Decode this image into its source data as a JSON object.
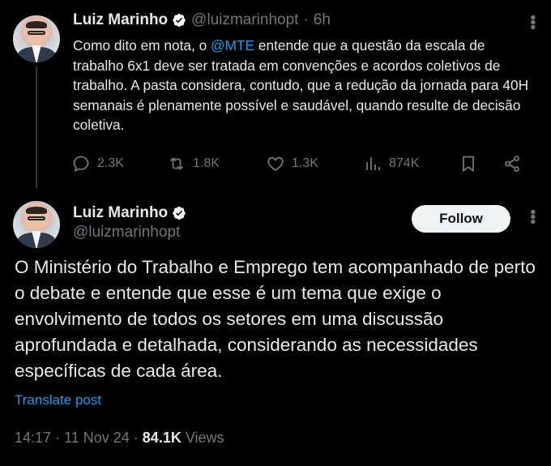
{
  "tweet1": {
    "author_name": "Luiz Marinho",
    "handle": "@luizmarinhopt",
    "time_sep": "·",
    "time": "6h",
    "text_before": "Como dito em nota, o ",
    "mention": "@MTE",
    "text_after": " entende que a questão da escala de trabalho 6x1 deve ser tratada em convenções e acordos coletivos de trabalho. A pasta considera, contudo, que a redução da jornada para 40H semanais é plenamente possível e saudável, quando resulte de decisão coletiva.",
    "actions": {
      "replies": "2.3K",
      "reposts": "1.8K",
      "likes": "1.3K",
      "views": "874K"
    }
  },
  "tweet2": {
    "author_name": "Luiz Marinho",
    "handle": "@luizmarinhopt",
    "follow_label": "Follow",
    "text": "O Ministério do Trabalho e Emprego tem acompanhado de perto o debate e entende que esse é um tema que exige o envolvimento de todos os setores em uma discussão aprofundada e detalhada, considerando as necessidades específicas de cada área.",
    "translate_label": "Translate post",
    "time": "14:17",
    "date": "11 Nov 24",
    "views_count": "84.1K",
    "views_label": "Views"
  },
  "colors": {
    "background": "#000000",
    "text": "#e7e9ea",
    "secondary": "#71767b",
    "accent": "#1d9bf0"
  }
}
